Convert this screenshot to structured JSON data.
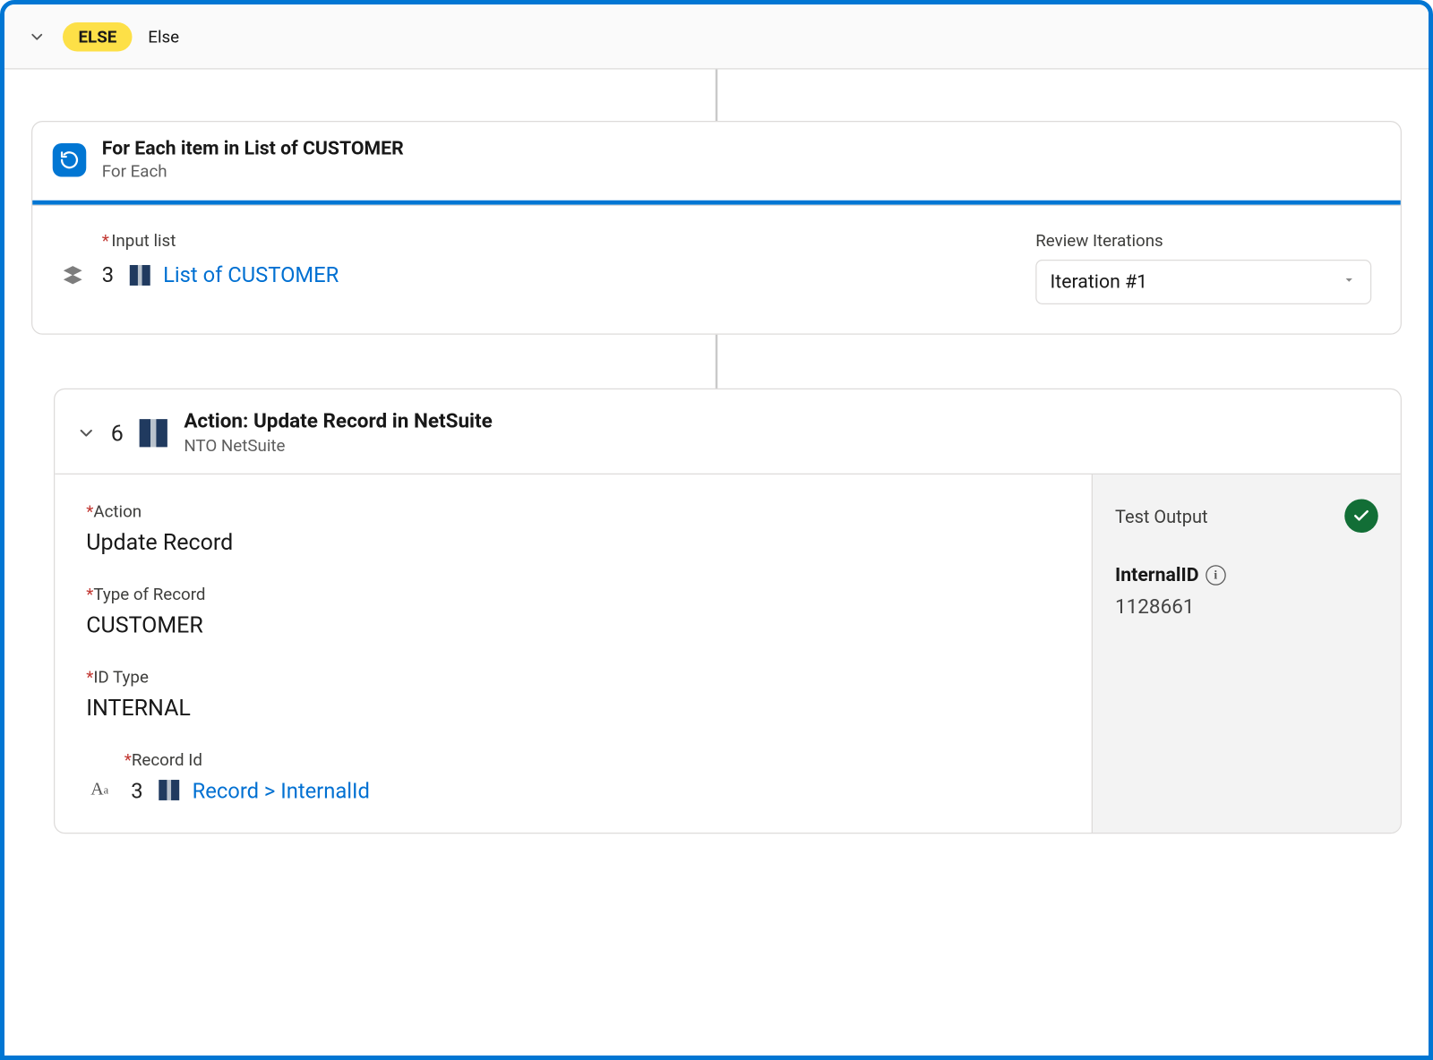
{
  "elseStrip": {
    "badge": "ELSE",
    "label": "Else"
  },
  "foreach": {
    "title": "For Each item in List of CUSTOMER",
    "subtitle": "For Each",
    "inputList": {
      "label": "Input list",
      "stepNumber": "3",
      "linkText": "List of CUSTOMER"
    },
    "review": {
      "label": "Review Iterations",
      "selected": "Iteration #1"
    }
  },
  "action": {
    "stepNumber": "6",
    "title": "Action: Update Record in NetSuite",
    "subtitle": "NTO NetSuite",
    "fields": {
      "action": {
        "label": "Action",
        "value": "Update Record"
      },
      "typeOfRecord": {
        "label": "Type of Record",
        "value": "CUSTOMER"
      },
      "idType": {
        "label": "ID Type",
        "value": "INTERNAL"
      },
      "recordId": {
        "label": "Record Id",
        "stepNumber": "3",
        "linkText": "Record > InternalId"
      }
    },
    "output": {
      "title": "Test Output",
      "field": {
        "name": "InternalID",
        "value": "1128661"
      }
    }
  }
}
